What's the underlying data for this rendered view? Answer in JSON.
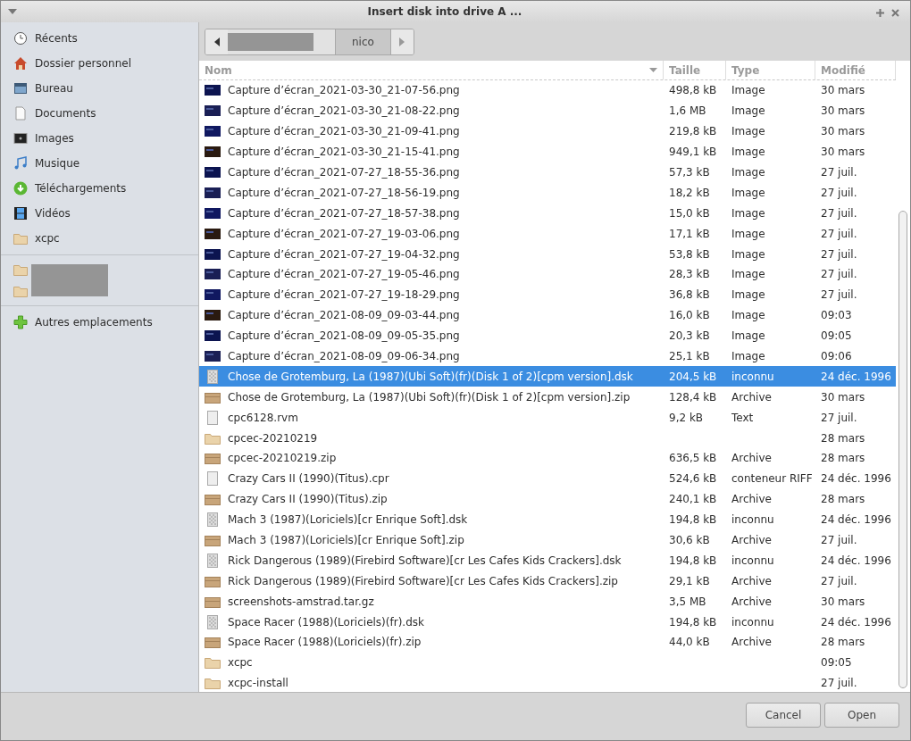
{
  "window": {
    "title": "Insert disk into drive A ..."
  },
  "sidebar": {
    "places": [
      {
        "label": "Récents",
        "kind": "recent"
      },
      {
        "label": "Dossier personnel",
        "kind": "home"
      },
      {
        "label": "Bureau",
        "kind": "desktop"
      },
      {
        "label": "Documents",
        "kind": "document"
      },
      {
        "label": "Images",
        "kind": "pictures"
      },
      {
        "label": "Musique",
        "kind": "music"
      },
      {
        "label": "Téléchargements",
        "kind": "download"
      },
      {
        "label": "Vidéos",
        "kind": "video"
      },
      {
        "label": "xcpc",
        "kind": "folder"
      }
    ],
    "bookmarks": [
      {
        "kind": "folder"
      },
      {
        "kind": "folder"
      }
    ],
    "other": [
      {
        "label": "Autres emplacements",
        "kind": "add"
      }
    ]
  },
  "path_bar": {
    "segments": [
      {
        "label": "nico",
        "selected": true
      }
    ]
  },
  "table": {
    "columns": [
      "Nom",
      "Taille",
      "Type",
      "Modifié"
    ],
    "rows": [
      {
        "kind": "image",
        "name": "Capture d’écran_2021-03-30_21-07-56.png",
        "size": "498,8 kB",
        "type": "Image",
        "modified": "30 mars",
        "selected": false
      },
      {
        "kind": "image",
        "name": "Capture d’écran_2021-03-30_21-08-22.png",
        "size": "1,6 MB",
        "type": "Image",
        "modified": "30 mars",
        "selected": false
      },
      {
        "kind": "image",
        "name": "Capture d’écran_2021-03-30_21-09-41.png",
        "size": "219,8 kB",
        "type": "Image",
        "modified": "30 mars",
        "selected": false
      },
      {
        "kind": "image",
        "name": "Capture d’écran_2021-03-30_21-15-41.png",
        "size": "949,1 kB",
        "type": "Image",
        "modified": "30 mars",
        "selected": false
      },
      {
        "kind": "image",
        "name": "Capture d’écran_2021-07-27_18-55-36.png",
        "size": "57,3 kB",
        "type": "Image",
        "modified": "27 juil.",
        "selected": false
      },
      {
        "kind": "image",
        "name": "Capture d’écran_2021-07-27_18-56-19.png",
        "size": "18,2 kB",
        "type": "Image",
        "modified": "27 juil.",
        "selected": false
      },
      {
        "kind": "image",
        "name": "Capture d’écran_2021-07-27_18-57-38.png",
        "size": "15,0 kB",
        "type": "Image",
        "modified": "27 juil.",
        "selected": false
      },
      {
        "kind": "image",
        "name": "Capture d’écran_2021-07-27_19-03-06.png",
        "size": "17,1 kB",
        "type": "Image",
        "modified": "27 juil.",
        "selected": false
      },
      {
        "kind": "image",
        "name": "Capture d’écran_2021-07-27_19-04-32.png",
        "size": "53,8 kB",
        "type": "Image",
        "modified": "27 juil.",
        "selected": false
      },
      {
        "kind": "image",
        "name": "Capture d’écran_2021-07-27_19-05-46.png",
        "size": "28,3 kB",
        "type": "Image",
        "modified": "27 juil.",
        "selected": false
      },
      {
        "kind": "image",
        "name": "Capture d’écran_2021-07-27_19-18-29.png",
        "size": "36,8 kB",
        "type": "Image",
        "modified": "27 juil.",
        "selected": false
      },
      {
        "kind": "image",
        "name": "Capture d’écran_2021-08-09_09-03-44.png",
        "size": "16,0 kB",
        "type": "Image",
        "modified": "09:03",
        "selected": false
      },
      {
        "kind": "image",
        "name": "Capture d’écran_2021-08-09_09-05-35.png",
        "size": "20,3 kB",
        "type": "Image",
        "modified": "09:05",
        "selected": false
      },
      {
        "kind": "image",
        "name": "Capture d’écran_2021-08-09_09-06-34.png",
        "size": "25,1 kB",
        "type": "Image",
        "modified": "09:06",
        "selected": false
      },
      {
        "kind": "disk",
        "name": "Chose de Grotemburg, La (1987)(Ubi Soft)(fr)(Disk 1 of 2)[cpm version].dsk",
        "size": "204,5 kB",
        "type": "inconnu",
        "modified": "24 déc. 1996",
        "selected": true
      },
      {
        "kind": "archive",
        "name": "Chose de Grotemburg, La (1987)(Ubi Soft)(fr)(Disk 1 of 2)[cpm version].zip",
        "size": "128,4 kB",
        "type": "Archive",
        "modified": "30 mars",
        "selected": false
      },
      {
        "kind": "text",
        "name": "cpc6128.rvm",
        "size": "9,2 kB",
        "type": "Text",
        "modified": "27 juil.",
        "selected": false
      },
      {
        "kind": "folder",
        "name": "cpcec-20210219",
        "modified": "28 mars",
        "selected": false
      },
      {
        "kind": "archive",
        "name": "cpcec-20210219.zip",
        "size": "636,5 kB",
        "type": "Archive",
        "modified": "28 mars",
        "selected": false
      },
      {
        "kind": "text",
        "name": "Crazy Cars II (1990)(Titus).cpr",
        "size": "524,6 kB",
        "type": "conteneur RIFF",
        "modified": "24 déc. 1996",
        "selected": false
      },
      {
        "kind": "archive",
        "name": "Crazy Cars II (1990)(Titus).zip",
        "size": "240,1 kB",
        "type": "Archive",
        "modified": "28 mars",
        "selected": false
      },
      {
        "kind": "disk",
        "name": "Mach 3 (1987)(Loriciels)[cr Enrique Soft].dsk",
        "size": "194,8 kB",
        "type": "inconnu",
        "modified": "24 déc. 1996",
        "selected": false
      },
      {
        "kind": "archive",
        "name": "Mach 3 (1987)(Loriciels)[cr Enrique Soft].zip",
        "size": "30,6 kB",
        "type": "Archive",
        "modified": "27 juil.",
        "selected": false
      },
      {
        "kind": "disk",
        "name": "Rick Dangerous (1989)(Firebird Software)[cr Les Cafes Kids Crackers].dsk",
        "size": "194,8 kB",
        "type": "inconnu",
        "modified": "24 déc. 1996",
        "selected": false
      },
      {
        "kind": "archive",
        "name": "Rick Dangerous (1989)(Firebird Software)[cr Les Cafes Kids Crackers].zip",
        "size": "29,1 kB",
        "type": "Archive",
        "modified": "27 juil.",
        "selected": false
      },
      {
        "kind": "archive",
        "name": "screenshots-amstrad.tar.gz",
        "size": "3,5 MB",
        "type": "Archive",
        "modified": "30 mars",
        "selected": false
      },
      {
        "kind": "disk",
        "name": "Space Racer (1988)(Loriciels)(fr).dsk",
        "size": "194,8 kB",
        "type": "inconnu",
        "modified": "24 déc. 1996",
        "selected": false
      },
      {
        "kind": "archive",
        "name": "Space Racer (1988)(Loriciels)(fr).zip",
        "size": "44,0 kB",
        "type": "Archive",
        "modified": "28 mars",
        "selected": false
      },
      {
        "kind": "folder",
        "name": "xcpc",
        "modified": "09:05",
        "selected": false
      },
      {
        "kind": "folder",
        "name": "xcpc-install",
        "modified": "27 juil.",
        "selected": false
      }
    ]
  },
  "buttons": [
    {
      "label": "Cancel"
    },
    {
      "label": "Open"
    }
  ]
}
